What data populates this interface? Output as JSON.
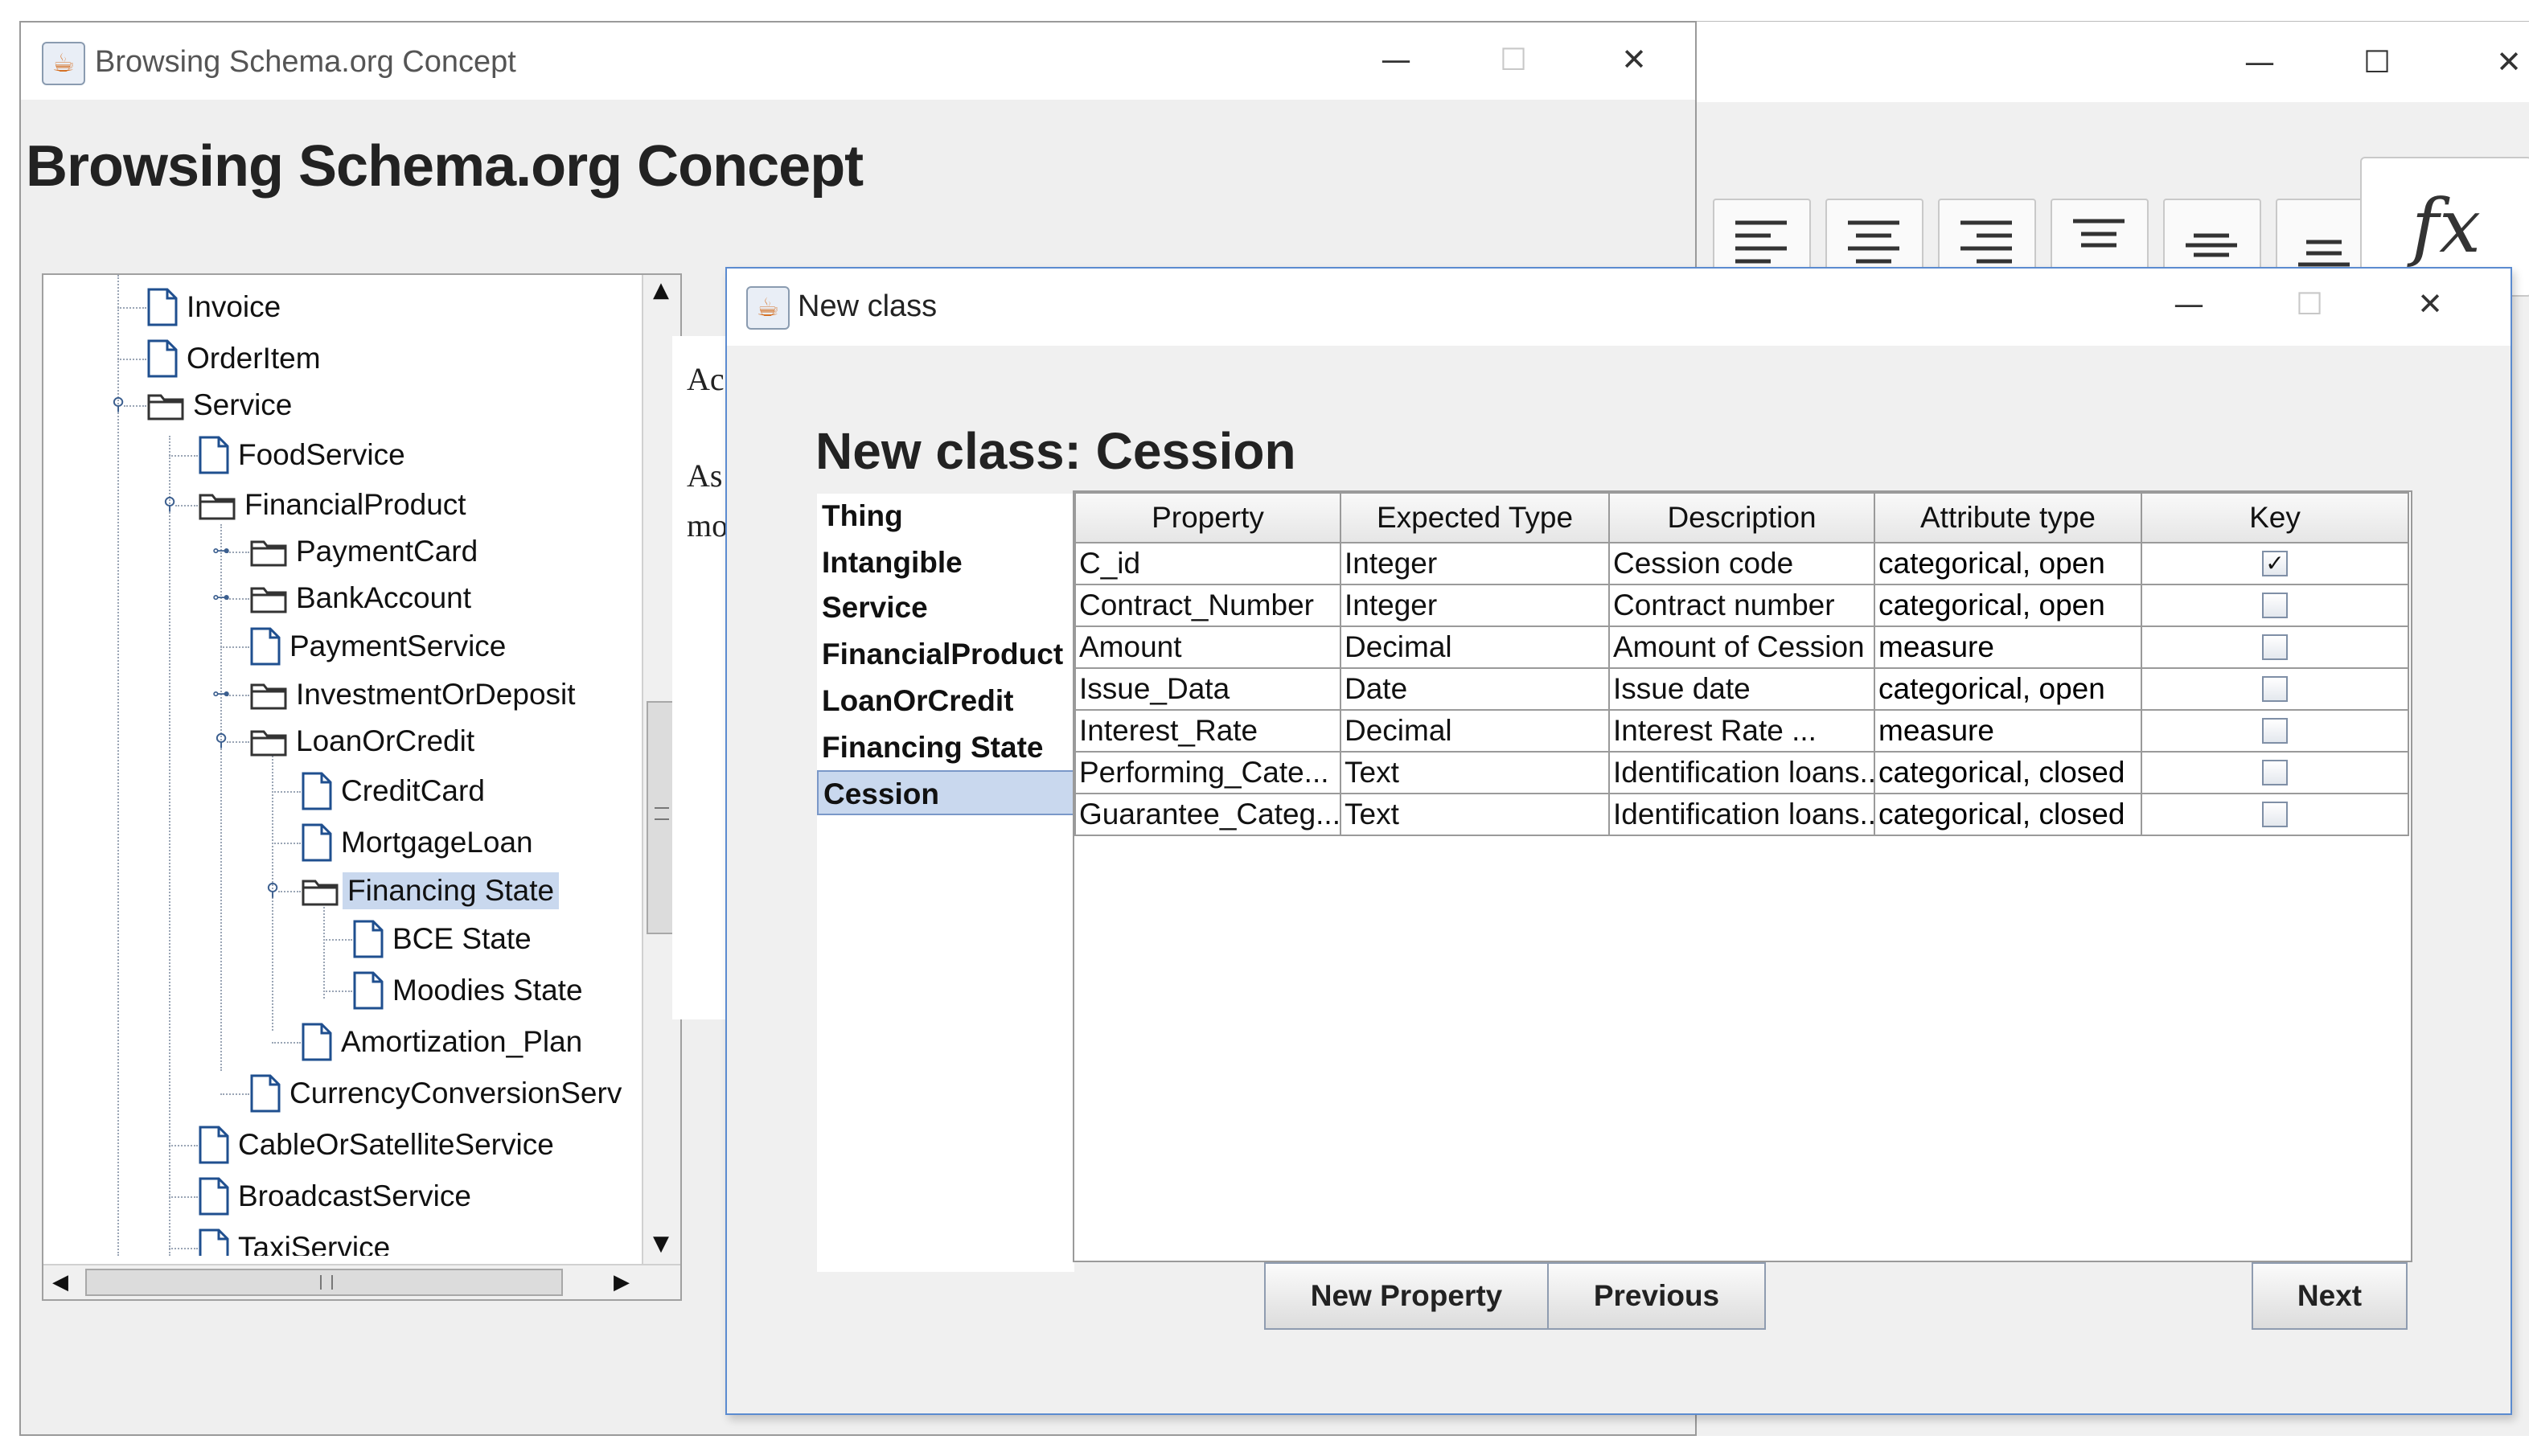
{
  "main_window": {
    "title": "Browsing Schema.org Concept",
    "heading": "Browsing Schema.org Concept",
    "tree_items": [
      {
        "label": "Invoice",
        "icon": "document-icon"
      },
      {
        "label": "OrderItem",
        "icon": "document-icon"
      },
      {
        "label": "Service",
        "icon": "folder-icon"
      },
      {
        "label": "FoodService",
        "icon": "document-icon"
      },
      {
        "label": "FinancialProduct",
        "icon": "folder-icon"
      },
      {
        "label": "PaymentCard",
        "icon": "folder-icon"
      },
      {
        "label": "BankAccount",
        "icon": "folder-icon"
      },
      {
        "label": "PaymentService",
        "icon": "document-icon"
      },
      {
        "label": "InvestmentOrDeposit",
        "icon": "folder-icon"
      },
      {
        "label": "LoanOrCredit",
        "icon": "folder-icon"
      },
      {
        "label": "CreditCard",
        "icon": "document-icon"
      },
      {
        "label": "MortgageLoan",
        "icon": "document-icon"
      },
      {
        "label": "Financing State",
        "icon": "folder-icon",
        "selected": true
      },
      {
        "label": "BCE State",
        "icon": "document-icon"
      },
      {
        "label": "Moodies State",
        "icon": "document-icon"
      },
      {
        "label": "Amortization_Plan",
        "icon": "document-icon"
      },
      {
        "label": "CurrencyConversionServ",
        "icon": "document-icon"
      },
      {
        "label": "CableOrSatelliteService",
        "icon": "document-icon"
      },
      {
        "label": "BroadcastService",
        "icon": "document-icon"
      },
      {
        "label": "TaxiService",
        "icon": "document-icon"
      }
    ],
    "doc_fragments": [
      "Acc",
      "As ",
      "mor"
    ]
  },
  "dialog": {
    "title": "New class",
    "heading": "New class: Cession",
    "class_path": [
      "Thing",
      "Intangible",
      "Service",
      "FinancialProduct",
      "LoanOrCredit",
      "Financing State",
      "Cession"
    ],
    "selected_class": "Cession",
    "table": {
      "columns": [
        "Property",
        "Expected Type",
        "Description",
        "Attribute type",
        "Key"
      ],
      "rows": [
        {
          "property": "C_id",
          "type": "Integer",
          "description": "Cession code",
          "attribute_type": "categorical, open",
          "key": true
        },
        {
          "property": "Contract_Number",
          "type": "Integer",
          "description": "Contract number",
          "attribute_type": "categorical, open",
          "key": false
        },
        {
          "property": "Amount",
          "type": "Decimal",
          "description": "Amount of Cession",
          "attribute_type": "measure",
          "key": false
        },
        {
          "property": "Issue_Data",
          "type": "Date",
          "description": "Issue date",
          "attribute_type": "categorical, open",
          "key": false
        },
        {
          "property": "Interest_Rate",
          "type": "Decimal",
          "description": "Interest Rate ...",
          "attribute_type": "measure",
          "key": false
        },
        {
          "property": "Performing_Cate...",
          "type": "Text",
          "description": "Identification loans...",
          "attribute_type": "categorical, closed",
          "key": false
        },
        {
          "property": "Guarantee_Categ...",
          "type": "Text",
          "description": "Identification loans...",
          "attribute_type": "categorical, closed",
          "key": false
        }
      ]
    },
    "buttons": {
      "new_property": "New Property",
      "previous": "Previous",
      "next": "Next"
    }
  },
  "background_window": {
    "toolbar_icons": [
      "align-left-icon",
      "align-center-icon",
      "align-right-icon",
      "align-top-icon",
      "align-middle-icon",
      "align-bottom-icon"
    ],
    "formula_label": "fx"
  },
  "window_controls": {
    "minimize": "—",
    "maximize": "☐",
    "close": "✕"
  }
}
